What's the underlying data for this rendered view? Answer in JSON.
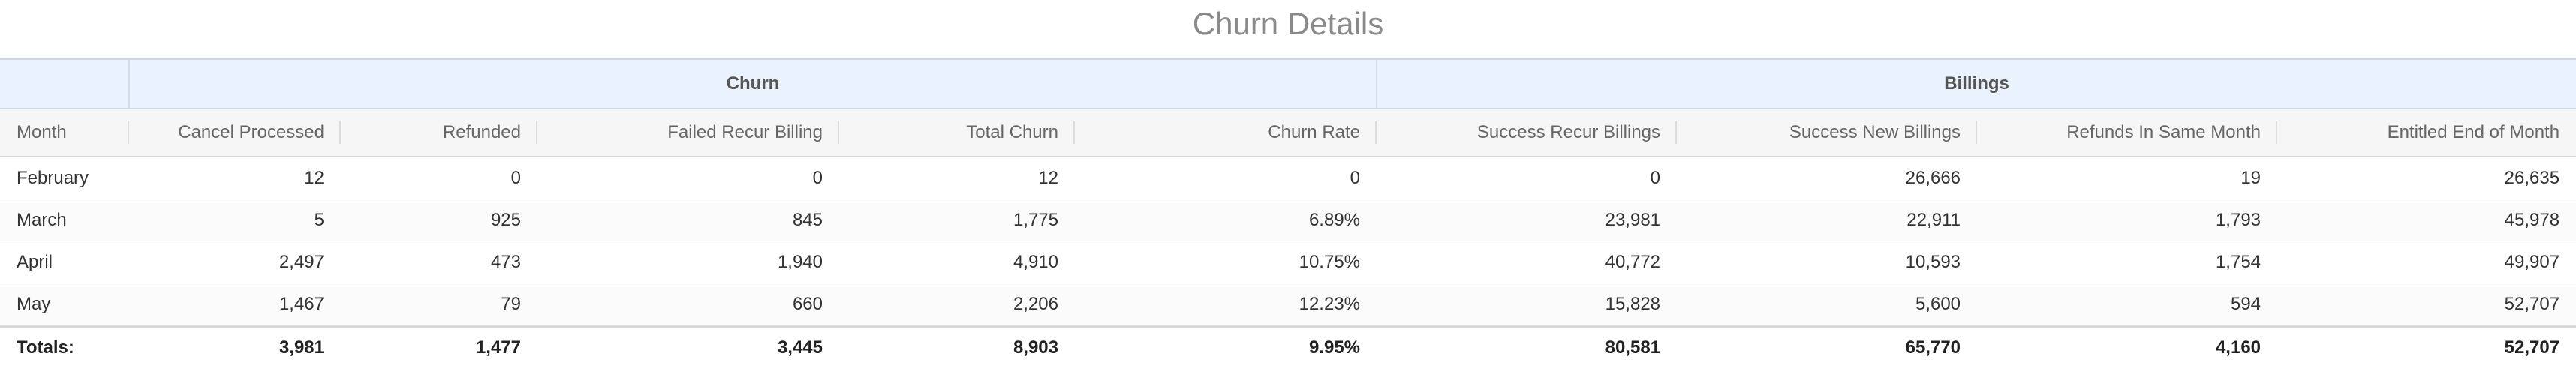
{
  "title": "Churn Details",
  "groups": {
    "churn": "Churn",
    "billings": "Billings"
  },
  "columns": [
    "Month",
    "Cancel Processed",
    "Refunded",
    "Failed Recur Billing",
    "Total Churn",
    "Churn Rate",
    "Success Recur Billings",
    "Success New Billings",
    "Refunds In Same Month",
    "Entitled End of Month"
  ],
  "rows": [
    [
      "February",
      "12",
      "0",
      "0",
      "12",
      "0",
      "0",
      "26,666",
      "19",
      "26,635"
    ],
    [
      "March",
      "5",
      "925",
      "845",
      "1,775",
      "6.89%",
      "23,981",
      "22,911",
      "1,793",
      "45,978"
    ],
    [
      "April",
      "2,497",
      "473",
      "1,940",
      "4,910",
      "10.75%",
      "40,772",
      "10,593",
      "1,754",
      "49,907"
    ],
    [
      "May",
      "1,467",
      "79",
      "660",
      "2,206",
      "12.23%",
      "15,828",
      "5,600",
      "594",
      "52,707"
    ]
  ],
  "totals": [
    "Totals:",
    "3,981",
    "1,477",
    "3,445",
    "8,903",
    "9.95%",
    "80,581",
    "65,770",
    "4,160",
    "52,707"
  ]
}
